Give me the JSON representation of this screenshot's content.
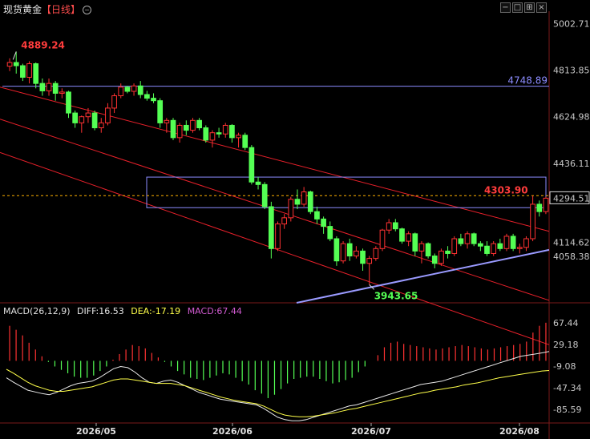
{
  "header": {
    "title": "现货黄金",
    "period": "【日线】",
    "toggle_icon": "circle-minus-icon",
    "window_buttons": [
      "minimize-icon",
      "restore-icon",
      "tile-icon",
      "close-icon"
    ]
  },
  "colors": {
    "up": "#ff3232",
    "down": "#54ff54",
    "channel": "#e8202a",
    "box": "#8c8cff",
    "support": "#9a9aff",
    "current": "#ffb000",
    "diff_line": "#e8e8e8",
    "dea_line": "#ffff4a",
    "macd_label": "#d35cd3"
  },
  "chart_data": [
    {
      "type": "candlestick",
      "title": "现货黄金【日线】",
      "x_labels": [
        "2026/05",
        "2026/06",
        "2026/07",
        "2026/08"
      ],
      "y_ticks": [
        5002.71,
        4813.85,
        4624.98,
        4436.11,
        4294.51,
        4114.62,
        4058.38
      ],
      "ylim": [
        3870,
        5040
      ],
      "grid": false,
      "current_price": 4294.51,
      "annotations": [
        {
          "text": "4889.24",
          "value": 4889.24,
          "kind": "high"
        },
        {
          "text": "3943.65",
          "value": 3943.65,
          "kind": "low"
        },
        {
          "text": "4303.90",
          "value": 4303.9,
          "kind": "recent-high"
        },
        {
          "text": "4748.89",
          "value": 4748.89,
          "kind": "horizontal-level"
        }
      ],
      "candles": [
        [
          4830,
          4862,
          4810,
          4845
        ],
        [
          4845,
          4889.24,
          4800,
          4832
        ],
        [
          4832,
          4840,
          4770,
          4785
        ],
        [
          4785,
          4850,
          4760,
          4840
        ],
        [
          4840,
          4845,
          4740,
          4760
        ],
        [
          4760,
          4780,
          4710,
          4730
        ],
        [
          4730,
          4780,
          4710,
          4760
        ],
        [
          4760,
          4770,
          4690,
          4720
        ],
        [
          4720,
          4740,
          4700,
          4725
        ],
        [
          4725,
          4730,
          4620,
          4640
        ],
        [
          4640,
          4650,
          4580,
          4600
        ],
        [
          4600,
          4630,
          4560,
          4625
        ],
        [
          4625,
          4660,
          4600,
          4640
        ],
        [
          4640,
          4650,
          4570,
          4580
        ],
        [
          4580,
          4620,
          4560,
          4600
        ],
        [
          4600,
          4680,
          4590,
          4660
        ],
        [
          4660,
          4720,
          4640,
          4710
        ],
        [
          4710,
          4760,
          4700,
          4745
        ],
        [
          4745,
          4750,
          4720,
          4728
        ],
        [
          4728,
          4760,
          4710,
          4750
        ],
        [
          4750,
          4770,
          4700,
          4715
        ],
        [
          4715,
          4730,
          4690,
          4700
        ],
        [
          4700,
          4720,
          4680,
          4690
        ],
        [
          4690,
          4700,
          4580,
          4600
        ],
        [
          4600,
          4620,
          4560,
          4610
        ],
        [
          4610,
          4620,
          4530,
          4540
        ],
        [
          4540,
          4600,
          4520,
          4590
        ],
        [
          4590,
          4610,
          4550,
          4570
        ],
        [
          4570,
          4620,
          4560,
          4610
        ],
        [
          4610,
          4620,
          4570,
          4580
        ],
        [
          4580,
          4590,
          4520,
          4530
        ],
        [
          4530,
          4570,
          4500,
          4560
        ],
        [
          4560,
          4580,
          4540,
          4555
        ],
        [
          4555,
          4600,
          4540,
          4590
        ],
        [
          4590,
          4595,
          4520,
          4540
        ],
        [
          4540,
          4560,
          4500,
          4550
        ],
        [
          4550,
          4560,
          4490,
          4500
        ],
        [
          4500,
          4510,
          4350,
          4360
        ],
        [
          4360,
          4380,
          4330,
          4350
        ],
        [
          4350,
          4360,
          4250,
          4260
        ],
        [
          4260,
          4280,
          4050,
          4090
        ],
        [
          4090,
          4200,
          4080,
          4190
        ],
        [
          4190,
          4230,
          4170,
          4215
        ],
        [
          4215,
          4300,
          4200,
          4290
        ],
        [
          4290,
          4330,
          4250,
          4270
        ],
        [
          4270,
          4340,
          4260,
          4320
        ],
        [
          4320,
          4325,
          4230,
          4240
        ],
        [
          4240,
          4260,
          4190,
          4210
        ],
        [
          4210,
          4220,
          4150,
          4180
        ],
        [
          4180,
          4200,
          4120,
          4130
        ],
        [
          4130,
          4140,
          4020,
          4040
        ],
        [
          4040,
          4120,
          4030,
          4110
        ],
        [
          4110,
          4130,
          4040,
          4060
        ],
        [
          4060,
          4100,
          4050,
          4080
        ],
        [
          4080,
          4090,
          4000,
          4030
        ],
        [
          4030,
          4060,
          3943.65,
          4050
        ],
        [
          4050,
          4100,
          4040,
          4090
        ],
        [
          4090,
          4170,
          4080,
          4165
        ],
        [
          4165,
          4210,
          4150,
          4195
        ],
        [
          4195,
          4210,
          4160,
          4170
        ],
        [
          4170,
          4175,
          4110,
          4120
        ],
        [
          4120,
          4160,
          4100,
          4150
        ],
        [
          4150,
          4155,
          4060,
          4080
        ],
        [
          4080,
          4120,
          4030,
          4110
        ],
        [
          4110,
          4115,
          4050,
          4060
        ],
        [
          4060,
          4070,
          4010,
          4030
        ],
        [
          4030,
          4090,
          4020,
          4080
        ],
        [
          4080,
          4100,
          4050,
          4070
        ],
        [
          4070,
          4140,
          4060,
          4130
        ],
        [
          4130,
          4150,
          4100,
          4110
        ],
        [
          4110,
          4160,
          4090,
          4150
        ],
        [
          4150,
          4155,
          4100,
          4110
        ],
        [
          4110,
          4120,
          4080,
          4100
        ],
        [
          4100,
          4120,
          4060,
          4070
        ],
        [
          4070,
          4120,
          4060,
          4110
        ],
        [
          4110,
          4130,
          4080,
          4090
        ],
        [
          4090,
          4150,
          4080,
          4140
        ],
        [
          4140,
          4150,
          4080,
          4090
        ],
        [
          4090,
          4110,
          4070,
          4095
        ],
        [
          4095,
          4140,
          4080,
          4130
        ],
        [
          4130,
          4303.9,
          4120,
          4270
        ],
        [
          4270,
          4285,
          4220,
          4240
        ],
        [
          4240,
          4300,
          4230,
          4294.51
        ]
      ]
    },
    {
      "type": "bar",
      "title": "MACD(26,12,9)",
      "y_ticks": [
        67.44,
        29.18,
        -9.08,
        -47.34,
        -85.59
      ],
      "ylim": [
        -110,
        80
      ],
      "legend": [
        {
          "label": "DIFF:16.53",
          "color": "#e8e8e8"
        },
        {
          "label": "DEA:-17.19",
          "color": "#ffff4a"
        },
        {
          "label": "MACD:67.44",
          "color": "#d35cd3"
        }
      ],
      "series": [
        {
          "name": "MACD",
          "values": [
            62,
            55,
            45,
            32,
            20,
            8,
            -2,
            -10,
            -16,
            -22,
            -28,
            -30,
            -30,
            -26,
            -18,
            -10,
            2,
            12,
            20,
            28,
            26,
            22,
            14,
            6,
            -2,
            -10,
            -18,
            -24,
            -30,
            -32,
            -34,
            -30,
            -26,
            -22,
            -24,
            -30,
            -36,
            -42,
            -52,
            -58,
            -66,
            -60,
            -50,
            -40,
            -32,
            -30,
            -28,
            -28,
            -32,
            -36,
            -40,
            -38,
            -34,
            -30,
            -20,
            -10,
            0,
            10,
            24,
            32,
            34,
            30,
            28,
            26,
            24,
            22,
            20,
            22,
            24,
            26,
            28,
            26,
            24,
            22,
            20,
            22,
            24,
            26,
            28,
            30,
            34,
            50,
            62,
            67.44
          ]
        },
        {
          "name": "DIFF",
          "values": [
            -30,
            -38,
            -45,
            -52,
            -55,
            -58,
            -60,
            -56,
            -50,
            -44,
            -40,
            -38,
            -36,
            -30,
            -22,
            -14,
            -10,
            -12,
            -20,
            -30,
            -38,
            -40,
            -36,
            -34,
            -38,
            -44,
            -50,
            -56,
            -60,
            -64,
            -68,
            -70,
            -72,
            -74,
            -76,
            -78,
            -84,
            -92,
            -100,
            -104,
            -106,
            -106,
            -104,
            -100,
            -96,
            -92,
            -88,
            -84,
            -80,
            -78,
            -74,
            -70,
            -66,
            -62,
            -58,
            -54,
            -50,
            -46,
            -42,
            -40,
            -38,
            -36,
            -32,
            -28,
            -24,
            -20,
            -16,
            -12,
            -8,
            -4,
            0,
            4,
            8,
            10,
            12,
            14,
            16.53
          ]
        },
        {
          "name": "DEA",
          "values": [
            -15,
            -22,
            -30,
            -38,
            -44,
            -48,
            -52,
            -54,
            -54,
            -52,
            -50,
            -48,
            -46,
            -42,
            -38,
            -34,
            -32,
            -32,
            -34,
            -36,
            -38,
            -40,
            -40,
            -40,
            -42,
            -44,
            -48,
            -52,
            -56,
            -60,
            -64,
            -67,
            -70,
            -72,
            -74,
            -76,
            -80,
            -86,
            -92,
            -96,
            -98,
            -99,
            -99,
            -98,
            -96,
            -94,
            -92,
            -89,
            -86,
            -84,
            -81,
            -78,
            -75,
            -72,
            -69,
            -66,
            -63,
            -60,
            -57,
            -55,
            -52,
            -50,
            -48,
            -46,
            -43,
            -41,
            -39,
            -36,
            -33,
            -30,
            -28,
            -26,
            -24,
            -22,
            -20,
            -18,
            -17.19
          ]
        }
      ]
    }
  ]
}
